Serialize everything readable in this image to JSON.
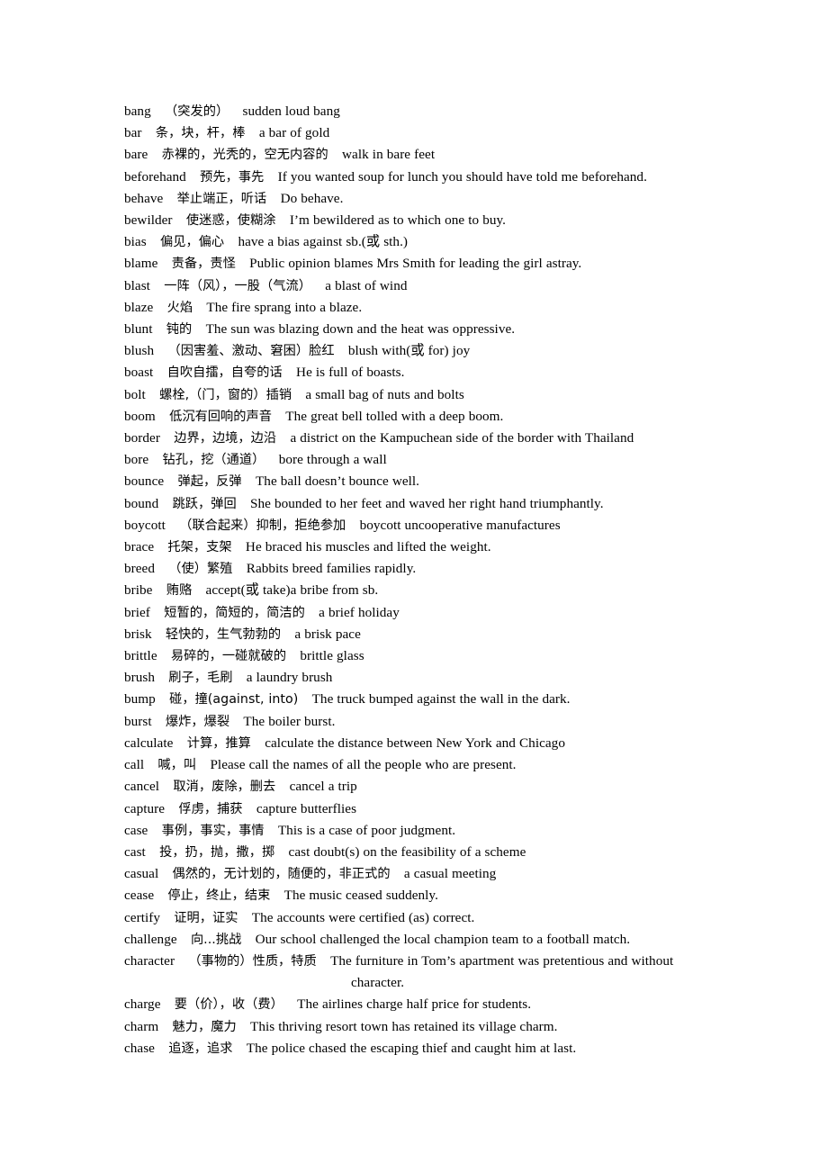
{
  "document": {
    "type": "vocabulary-list",
    "page_background": "#ffffff",
    "text_color": "#000000",
    "entries": [
      {
        "word": "bang",
        "gloss": "（突发的）",
        "example": "sudden loud bang"
      },
      {
        "word": "bar",
        "gloss": "条，块，杆，棒",
        "example": "a bar of gold"
      },
      {
        "word": "bare",
        "gloss": "赤裸的，光秃的，空无内容的",
        "example": "walk in bare feet"
      },
      {
        "word": "beforehand",
        "gloss": "预先，事先",
        "example": "If you wanted soup for lunch you should have told me beforehand."
      },
      {
        "word": "behave",
        "gloss": "举止端正，听话",
        "example": "Do behave."
      },
      {
        "word": "bewilder",
        "gloss": "使迷惑，使糊涂",
        "example": "I’m bewildered as to which one to buy."
      },
      {
        "word": "bias",
        "gloss": "偏见，偏心",
        "example": "have a bias against sb.(或 sth.)"
      },
      {
        "word": "blame",
        "gloss": "责备，责怪",
        "example": "Public opinion blames Mrs Smith for leading the girl astray."
      },
      {
        "word": "blast",
        "gloss": "一阵（风），一股（气流）",
        "example": "a blast of wind"
      },
      {
        "word": "blaze",
        "gloss": "火焰",
        "example": "The fire sprang into a blaze."
      },
      {
        "word": "blunt",
        "gloss": "钝的",
        "example": "The sun was blazing down and the heat was oppressive."
      },
      {
        "word": "blush",
        "gloss": "（因害羞、激动、窘困）脸红",
        "example": "blush with(或 for) joy"
      },
      {
        "word": "boast",
        "gloss": "自吹自擂，自夸的话",
        "example": "He is full of boasts."
      },
      {
        "word": "bolt",
        "gloss": "螺栓,（门，窗的）插销",
        "example": "a small bag of nuts and bolts"
      },
      {
        "word": "boom",
        "gloss": "低沉有回响的声音",
        "example": "The great bell tolled with a deep boom."
      },
      {
        "word": "border",
        "gloss": "边界，边境，边沿",
        "example": "a district on the Kampuchean side of the border with Thailand"
      },
      {
        "word": "bore",
        "gloss": "钻孔，挖（通道）",
        "example": "bore through a wall"
      },
      {
        "word": "bounce",
        "gloss": "弹起，反弹",
        "example": "The ball doesn’t bounce well."
      },
      {
        "word": "bound",
        "gloss": "跳跃，弹回",
        "example": "She bounded to her feet and waved her right hand triumphantly."
      },
      {
        "word": "boycott",
        "gloss": "（联合起来）抑制，拒绝参加",
        "example": "boycott uncooperative manufactures"
      },
      {
        "word": "brace",
        "gloss": "托架，支架",
        "example": "He braced his muscles and lifted the weight."
      },
      {
        "word": "breed",
        "gloss": "（使）繁殖",
        "example": "Rabbits breed families rapidly."
      },
      {
        "word": "bribe",
        "gloss": "贿赂",
        "example": "accept(或 take)a bribe from sb."
      },
      {
        "word": "brief",
        "gloss": "短暂的，简短的，简洁的",
        "example": "a brief holiday"
      },
      {
        "word": "brisk",
        "gloss": "轻快的，生气勃勃的",
        "example": "a brisk pace"
      },
      {
        "word": "brittle",
        "gloss": "易碎的，一碰就破的",
        "example": "brittle glass"
      },
      {
        "word": "brush",
        "gloss": "刷子，毛刷",
        "example": "a laundry brush"
      },
      {
        "word": "bump",
        "gloss": "碰，撞(against, into)",
        "example": "The truck bumped against the wall in the dark."
      },
      {
        "word": "burst",
        "gloss": "爆炸，爆裂",
        "example": "The boiler burst."
      },
      {
        "word": "calculate",
        "gloss": "计算，推算",
        "example": "calculate the distance between New York and Chicago"
      },
      {
        "word": "call",
        "gloss": "喊，叫",
        "example": "Please call the names of all the people who are present."
      },
      {
        "word": "cancel",
        "gloss": "取消，废除，删去",
        "example": "cancel a trip"
      },
      {
        "word": "capture",
        "gloss": "俘虏，捕获",
        "example": "capture butterflies"
      },
      {
        "word": "case",
        "gloss": "事例，事实，事情",
        "example": "This is a case of poor judgment."
      },
      {
        "word": "cast",
        "gloss": "投，扔，抛，撒，掷",
        "example": "cast doubt(s) on the feasibility of a scheme"
      },
      {
        "word": "casual",
        "gloss": "偶然的，无计划的，随便的，非正式的",
        "example": "a casual meeting"
      },
      {
        "word": "cease",
        "gloss": "停止，终止，结束",
        "example": "The music ceased suddenly."
      },
      {
        "word": "certify",
        "gloss": "证明，证实",
        "example": "The accounts were certified (as) correct."
      },
      {
        "word": "challenge",
        "gloss": "向...挑战",
        "example": "Our school challenged the local champion team to a football match."
      },
      {
        "word": "character",
        "gloss": "（事物的）性质，特质",
        "example": "The furniture in Tom’s apartment was pretentious and without",
        "continuation": "character."
      },
      {
        "word": "charge",
        "gloss": "要（价），收（费）",
        "example": "The airlines charge half price for students."
      },
      {
        "word": "charm",
        "gloss": "魅力，魔力",
        "example": "This thriving resort town has retained its village charm."
      },
      {
        "word": "chase",
        "gloss": "追逐，追求",
        "example": "The police chased the escaping thief and caught him at last."
      }
    ]
  }
}
